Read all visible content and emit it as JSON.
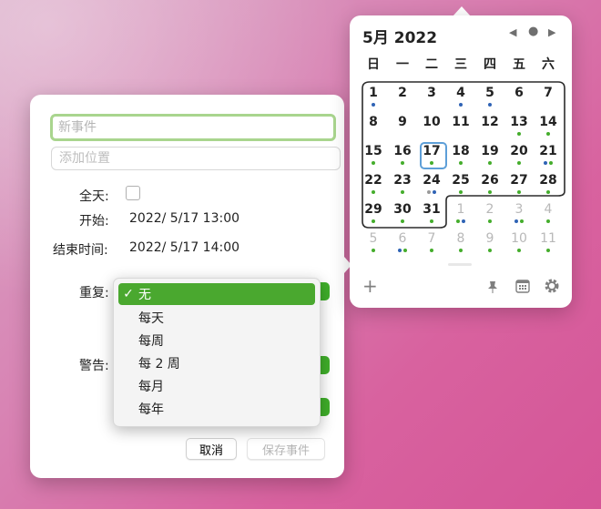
{
  "event": {
    "title_placeholder": "新事件",
    "location_placeholder": "添加位置",
    "allday_label": "全天:",
    "start_label": "开始:",
    "start_value": "2022/ 5/17 13:00",
    "end_label": "结束时间:",
    "end_value": "2022/ 5/17 14:00",
    "repeat_label": "重复:",
    "alert_label": "警告:",
    "cancel_label": "取消",
    "save_label": "保存事件"
  },
  "repeat_menu": {
    "options": [
      "无",
      "每天",
      "每周",
      "每 2 周",
      "每月",
      "每年"
    ],
    "selected": "无",
    "check": "✓"
  },
  "calendar": {
    "month_title": "5月 2022",
    "weekdays": [
      "日",
      "一",
      "二",
      "三",
      "四",
      "五",
      "六"
    ],
    "weeks": [
      [
        "1",
        "2",
        "3",
        "4",
        "5",
        "6",
        "7"
      ],
      [
        "8",
        "9",
        "10",
        "11",
        "12",
        "13",
        "14"
      ],
      [
        "15",
        "16",
        "17",
        "18",
        "19",
        "20",
        "21"
      ],
      [
        "22",
        "23",
        "24",
        "25",
        "26",
        "27",
        "28"
      ],
      [
        "29",
        "30",
        "31",
        "1",
        "2",
        "3",
        "4"
      ],
      [
        "5",
        "6",
        "7",
        "8",
        "9",
        "10",
        "11"
      ]
    ],
    "today": "17",
    "event_dot_colors": {
      "green": "#44ad2c",
      "blue": "#2f63b5",
      "gray": "#9a9a9a"
    },
    "icons": {
      "prev": "chevron-left-icon",
      "today": "dot-icon",
      "next": "chevron-right-icon",
      "add": "plus-icon",
      "pin": "pin-icon",
      "calendar": "calendar-icon",
      "settings": "gear-icon"
    }
  }
}
